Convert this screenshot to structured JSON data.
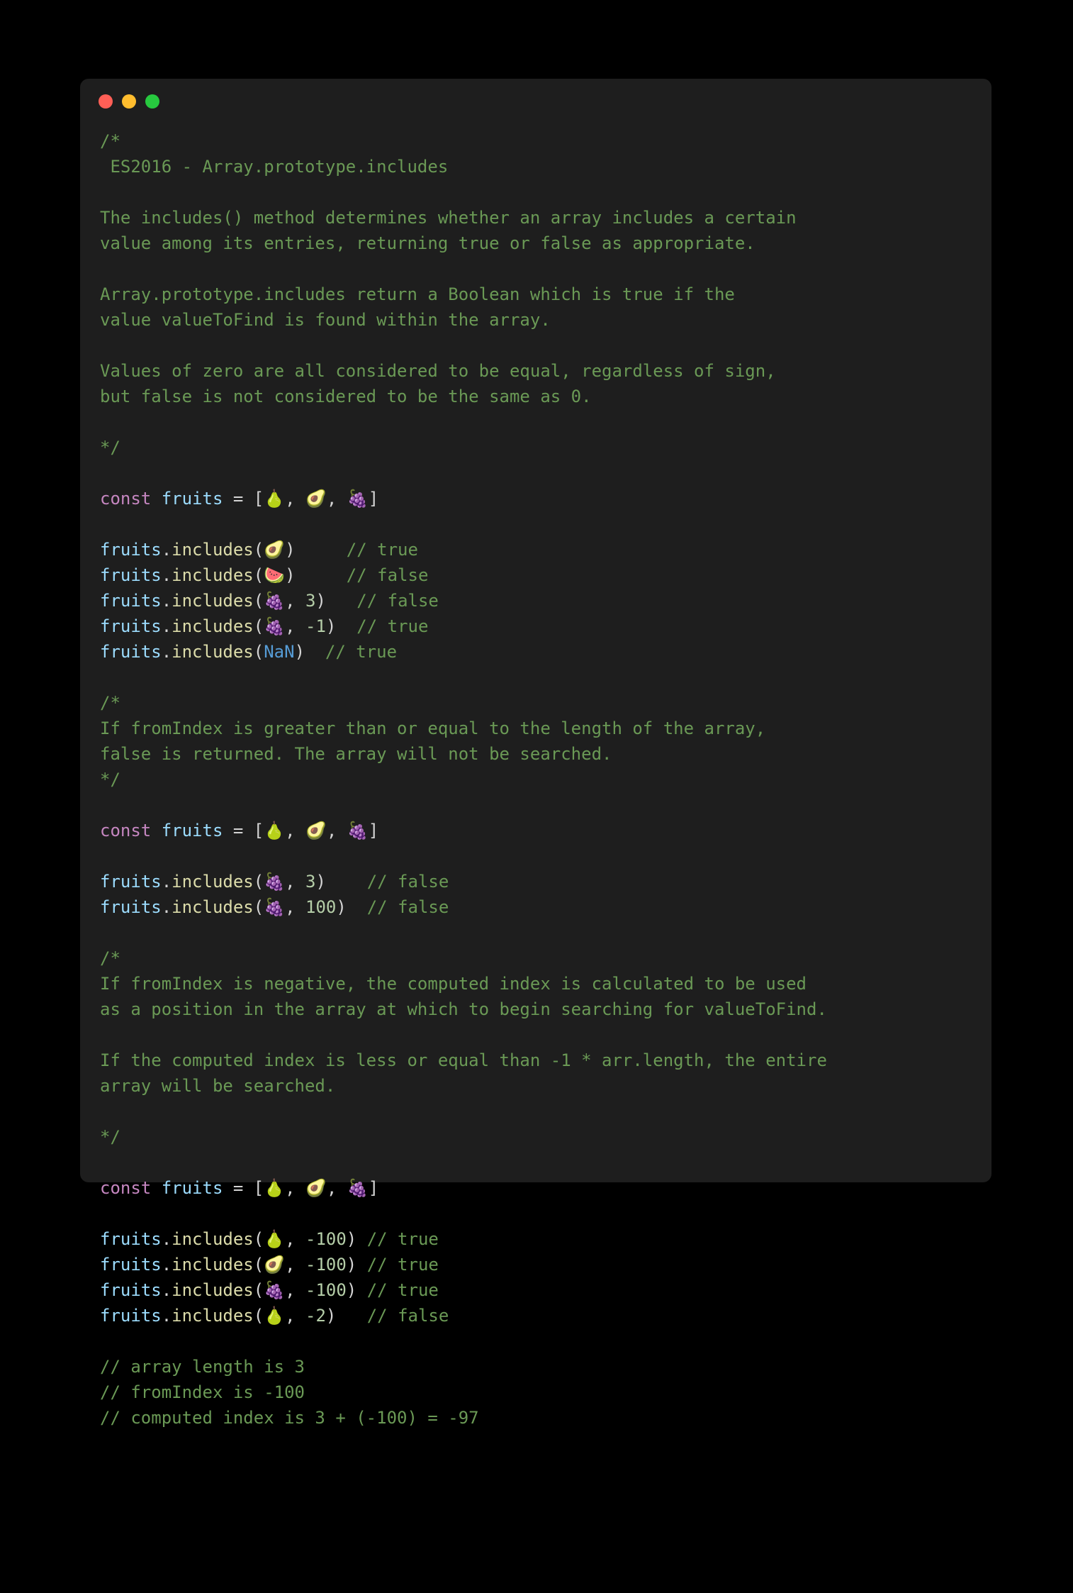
{
  "window": {
    "traffic_lights": [
      "red",
      "yellow",
      "green"
    ]
  },
  "code": {
    "comment1": "/*\n ES2016 - Array.prototype.includes\n\nThe includes() method determines whether an array includes a certain\nvalue among its entries, returning true or false as appropriate.\n\nArray.prototype.includes return a Boolean which is true if the\nvalue valueToFind is found within the array.\n\nValues of zero are all considered to be equal, regardless of sign,\nbut false is not considered to be the same as 0.\n\n*/",
    "const": "const",
    "fruitsVar": "fruits",
    "equals": " = ",
    "lbracket": "[",
    "rbracket": "]",
    "comma": ", ",
    "pear": "🍐",
    "avocado": "🥑",
    "grapes": "🍇",
    "watermelon": "🍉",
    "dot": ".",
    "includes": "includes",
    "lparen": "(",
    "rparen": ")",
    "nan": "NaN",
    "num3": "3",
    "numNeg1": "-1",
    "num100": "100",
    "numNeg100": "-100",
    "numNeg2": "-2",
    "cTrue": "// true",
    "cFalse": "// false",
    "comment2": "/*\nIf fromIndex is greater than or equal to the length of the array,\nfalse is returned. The array will not be searched.\n*/",
    "comment3": "/*\nIf fromIndex is negative, the computed index is calculated to be used\nas a position in the array at which to begin searching for valueToFind.\n\nIf the computed index is less or equal than -1 * arr.length, the entire\narray will be searched.\n\n*/",
    "tail1": "// array length is 3",
    "tail2": "// fromIndex is -100",
    "tail3": "// computed index is 3 + (-100) = -97"
  }
}
